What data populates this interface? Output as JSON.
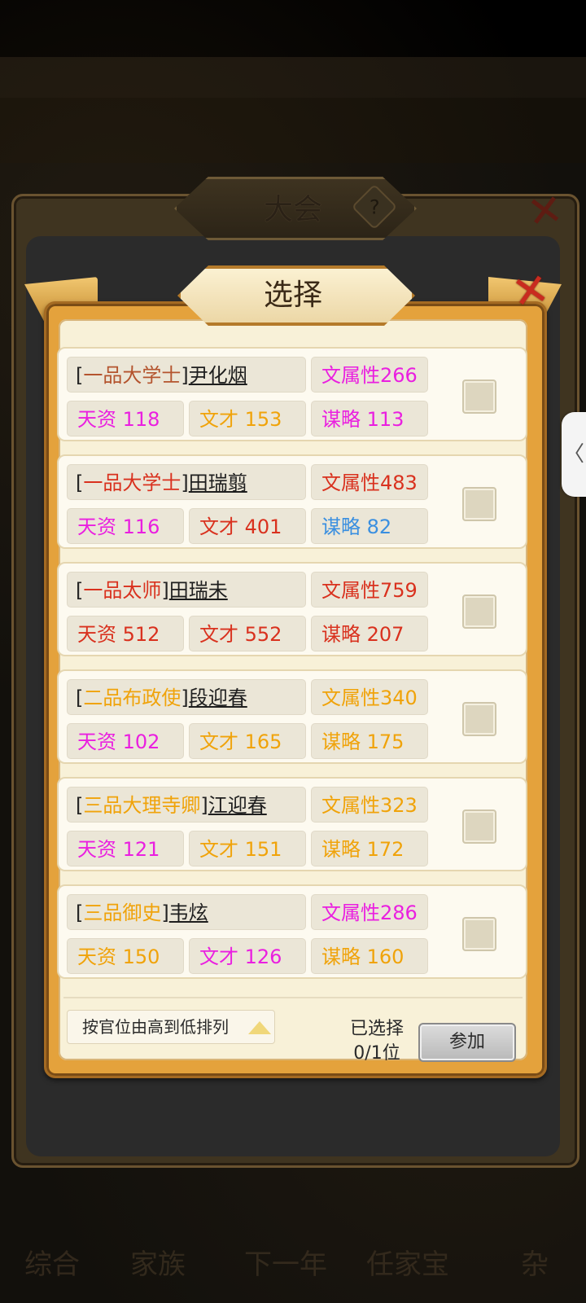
{
  "background": {
    "bottom_nav": [
      "综合",
      "家族",
      "下一年",
      "任家宝",
      "杂"
    ]
  },
  "outer_panel": {
    "title": "大会",
    "help_icon": "?",
    "close_icon": "✕"
  },
  "dialog": {
    "title": "选择",
    "close_icon": "✕",
    "candidates": [
      {
        "rank": "一品大学士",
        "rank_color": "#b4542e",
        "name": "尹化烟",
        "attribute": "文属性266",
        "attribute_color": "#ea1fe0",
        "stat1": "天资 118",
        "stat1_color": "#ea1fe0",
        "stat2": "文才 153",
        "stat2_color": "#f0a30a",
        "stat3": "谋略 113",
        "stat3_color": "#ea1fe0"
      },
      {
        "rank": "一品大学士",
        "rank_color": "#d9311e",
        "name": "田瑞翦",
        "attribute": "文属性483",
        "attribute_color": "#d9311e",
        "stat1": "天资 116",
        "stat1_color": "#ea1fe0",
        "stat2": "文才 401",
        "stat2_color": "#d9311e",
        "stat3": "谋略 82",
        "stat3_color": "#3a8fe0"
      },
      {
        "rank": "一品太师",
        "rank_color": "#d9311e",
        "name": "田瑞未",
        "attribute": "文属性759",
        "attribute_color": "#d9311e",
        "stat1": "天资 512",
        "stat1_color": "#d9311e",
        "stat2": "文才 552",
        "stat2_color": "#d9311e",
        "stat3": "谋略 207",
        "stat3_color": "#d9311e"
      },
      {
        "rank": "二品布政使",
        "rank_color": "#f0a30a",
        "name": "段迎春",
        "attribute": "文属性340",
        "attribute_color": "#f0a30a",
        "stat1": "天资 102",
        "stat1_color": "#ea1fe0",
        "stat2": "文才 165",
        "stat2_color": "#f0a30a",
        "stat3": "谋略 175",
        "stat3_color": "#f0a30a"
      },
      {
        "rank": "三品大理寺卿",
        "rank_color": "#f0a30a",
        "name": "江迎春",
        "attribute": "文属性323",
        "attribute_color": "#f0a30a",
        "stat1": "天资 121",
        "stat1_color": "#ea1fe0",
        "stat2": "文才 151",
        "stat2_color": "#f0a30a",
        "stat3": "谋略 172",
        "stat3_color": "#f0a30a"
      },
      {
        "rank": "三品御史",
        "rank_color": "#f0a30a",
        "name": "韦炫",
        "attribute": "文属性286",
        "attribute_color": "#ea1fe0",
        "stat1": "天资 150",
        "stat1_color": "#f0a30a",
        "stat2": "文才 126",
        "stat2_color": "#ea1fe0",
        "stat3": "谋略 160",
        "stat3_color": "#f0a30a"
      }
    ],
    "footer": {
      "sort_label": "按官位由高到低排列",
      "selected_label": "已选择",
      "selected_count": "0/1位",
      "join_button": "参加"
    }
  },
  "side_tab_icon": "〈"
}
